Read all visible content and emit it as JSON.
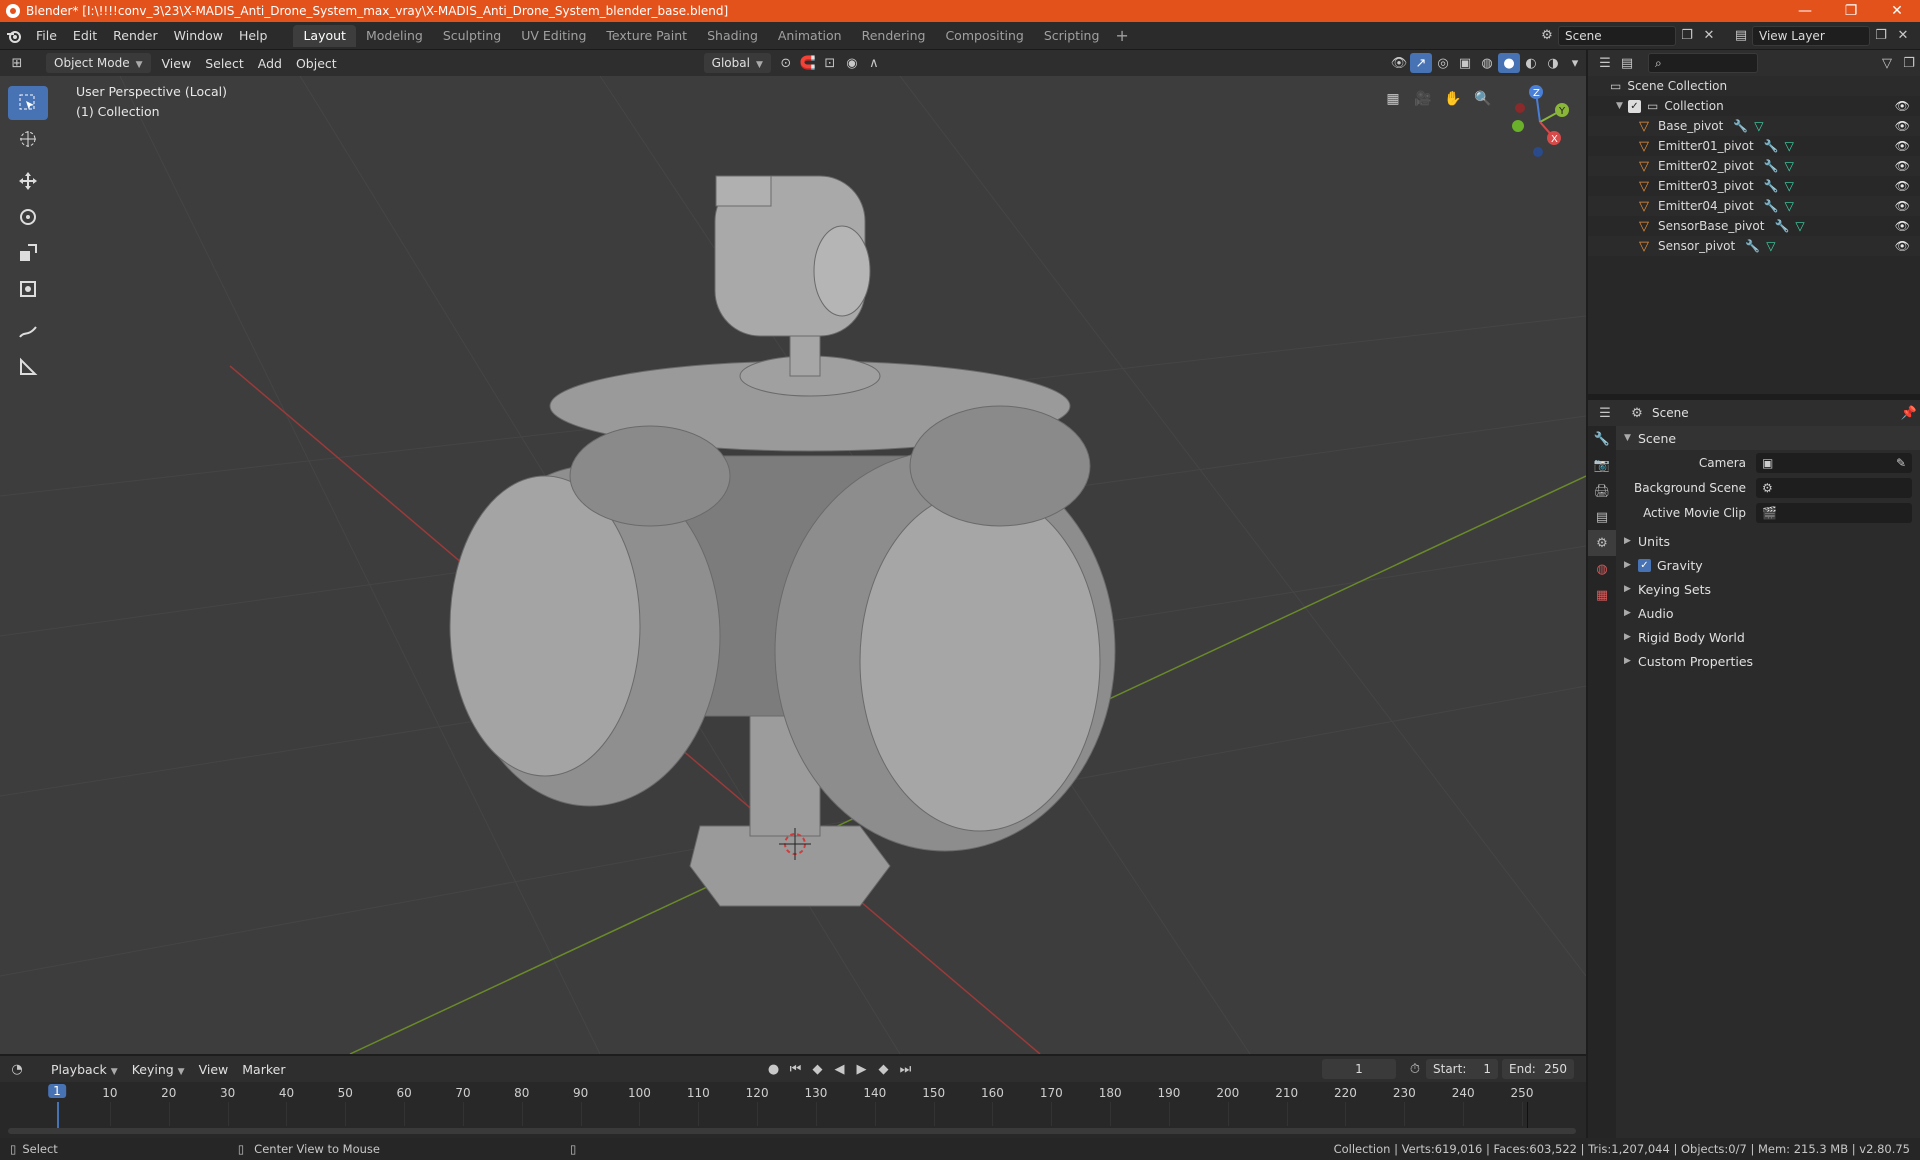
{
  "window": {
    "title": "Blender* [I:\\!!!!conv_3\\23\\X-MADIS_Anti_Drone_System_max_vray\\X-MADIS_Anti_Drone_System_blender_base.blend]",
    "minimize": "—",
    "maximize": "❐",
    "close": "✕"
  },
  "menu": {
    "file": "File",
    "edit": "Edit",
    "render": "Render",
    "window": "Window",
    "help": "Help"
  },
  "workspaces": [
    "Layout",
    "Modeling",
    "Sculpting",
    "UV Editing",
    "Texture Paint",
    "Shading",
    "Animation",
    "Rendering",
    "Compositing",
    "Scripting"
  ],
  "scene_field": "Scene",
  "view_layer_field": "View Layer",
  "viewport_header": {
    "mode": "Object Mode",
    "view": "View",
    "select": "Select",
    "add": "Add",
    "object": "Object",
    "orientation": "Global"
  },
  "viewport": {
    "perspective_label": "User Perspective (Local)",
    "collection_label": "(1) Collection",
    "gizmo": {
      "x": "X",
      "y": "Y",
      "z": "Z"
    }
  },
  "outliner": {
    "root": "Scene Collection",
    "collection": "Collection",
    "items": [
      "Base_pivot",
      "Emitter01_pivot",
      "Emitter02_pivot",
      "Emitter03_pivot",
      "Emitter04_pivot",
      "SensorBase_pivot",
      "Sensor_pivot"
    ]
  },
  "properties": {
    "header": "Scene",
    "section_scene": "Scene",
    "camera_label": "Camera",
    "background_scene_label": "Background Scene",
    "active_movie_clip_label": "Active Movie Clip",
    "panels": [
      "Units",
      "Gravity",
      "Keying Sets",
      "Audio",
      "Rigid Body World",
      "Custom Properties"
    ]
  },
  "timeline": {
    "playback": "Playback",
    "keying": "Keying",
    "view": "View",
    "marker": "Marker",
    "current_frame": "1",
    "start_label": "Start:",
    "start_value": "1",
    "end_label": "End:",
    "end_value": "250",
    "current_frame_marker": "1",
    "ticks": [
      "10",
      "20",
      "30",
      "40",
      "50",
      "60",
      "70",
      "80",
      "90",
      "100",
      "110",
      "120",
      "130",
      "140",
      "150",
      "160",
      "170",
      "180",
      "190",
      "200",
      "210",
      "220",
      "230",
      "240",
      "250"
    ]
  },
  "statusbar": {
    "select": "Select",
    "center_view": "Center View to Mouse",
    "stats": "Collection | Verts:619,016 | Faces:603,522 | Tris:1,207,044 | Objects:0/7 | Mem: 215.3 MB | v2.80.75"
  },
  "colors": {
    "titlebar": "#e4521c",
    "accent": "#4772b3",
    "object_icon": "#e88f3a",
    "mesh_icon": "#3fd6a8"
  }
}
